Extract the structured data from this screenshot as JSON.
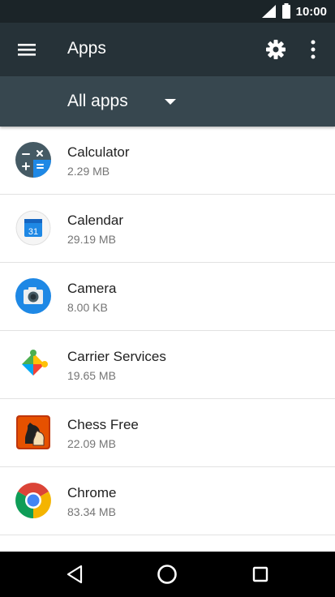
{
  "status_bar": {
    "time": "10:00"
  },
  "toolbar": {
    "title": "Apps"
  },
  "filter": {
    "selected": "All apps"
  },
  "apps": [
    {
      "name": "Calculator",
      "size": "2.29 MB"
    },
    {
      "name": "Calendar",
      "size": "29.19 MB",
      "icon_text": "31"
    },
    {
      "name": "Camera",
      "size": "8.00 KB"
    },
    {
      "name": "Carrier Services",
      "size": "19.65 MB"
    },
    {
      "name": "Chess Free",
      "size": "22.09 MB"
    },
    {
      "name": "Chrome",
      "size": "83.34 MB"
    }
  ],
  "colors": {
    "status_bar": "#1b2428",
    "toolbar": "#263238",
    "filter_bar": "#37474f",
    "nav_bar": "#000000"
  },
  "icons": {
    "toolbar": [
      "menu-icon",
      "settings-gear-icon",
      "more-vert-icon"
    ],
    "nav": [
      "back-icon",
      "home-icon",
      "recents-icon"
    ]
  }
}
